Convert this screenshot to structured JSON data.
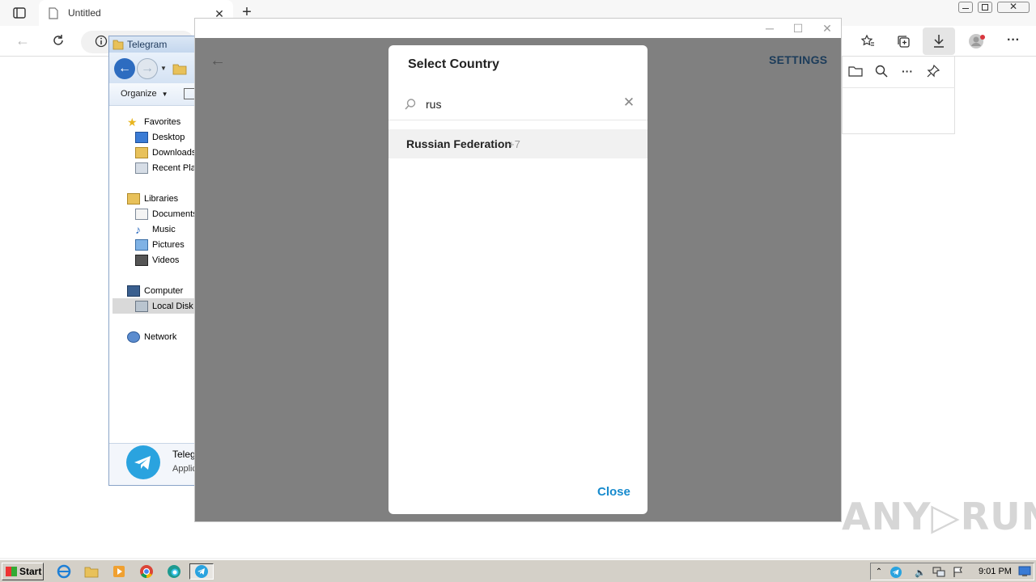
{
  "browser": {
    "tab_title": "Untitled",
    "new_tab_symbol": "+"
  },
  "explorer": {
    "title": "Telegram",
    "organize_label": "Organize",
    "tree": {
      "favorites": "Favorites",
      "desktop": "Desktop",
      "downloads": "Downloads",
      "recent": "Recent Plac",
      "libraries": "Libraries",
      "documents": "Documents",
      "music": "Music",
      "pictures": "Pictures",
      "videos": "Videos",
      "computer": "Computer",
      "local_disk": "Local Disk (",
      "network": "Network"
    },
    "detail_name": "Teleg",
    "detail_type": "Applic"
  },
  "telegram": {
    "settings_label": "SETTINGS",
    "dialog": {
      "title": "Select Country",
      "search_value": "rus",
      "result_name": "Russian Federation",
      "result_code": "+7",
      "close_label": "Close"
    }
  },
  "taskbar": {
    "start_label": "Start",
    "clock": "9:01 PM"
  },
  "watermark": "ANY▷RUN",
  "colors": {
    "accent": "#168acd",
    "overlay": "#808080",
    "telegram_blue": "#2aa3df"
  }
}
